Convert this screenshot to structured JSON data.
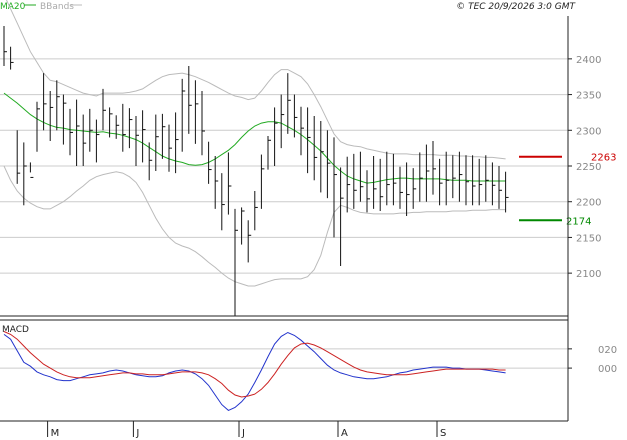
{
  "header": {
    "legend": [
      {
        "label": "MA20",
        "color": "#22aa22"
      },
      {
        "label": "BBands",
        "color": "#aaaaaa"
      }
    ],
    "copyright": "© TEC 20/9/2026 3:0 GMT"
  },
  "macd_label": "MACD",
  "colors": {
    "bar": "#111111",
    "ma": "#22aa22",
    "bands": "#bbbbbb",
    "grid": "#cccccc",
    "panel_border": "#222222",
    "resistance": "#cc0000",
    "support": "#008800",
    "macd": "#2233cc",
    "signal": "#cc2222",
    "axis_text": "#888888"
  },
  "chart_data": [
    {
      "type": "line",
      "subtype": "ohlc-bar",
      "title": "",
      "x_labels": [
        "M",
        "J",
        "J",
        "A",
        "S"
      ],
      "x_label_index": [
        6,
        19,
        35,
        50,
        65
      ],
      "yaxis": {
        "side": "right",
        "ticks": [
          2100,
          2150,
          2200,
          2250,
          2300,
          2350,
          2400
        ],
        "ylim": [
          2040,
          2460
        ]
      },
      "grid": true,
      "levels": [
        {
          "name": "resistance",
          "value": 2263,
          "label": "2263"
        },
        {
          "name": "support",
          "value": 2174,
          "label": "2174"
        }
      ],
      "series": [
        {
          "name": "Price",
          "kind": "ohlc",
          "high": [
            2446,
            2417,
            2300,
            2283,
            2241,
            2340,
            2380,
            2355,
            2370,
            2350,
            2330,
            2343,
            2322,
            2330,
            2315,
            2358,
            2332,
            2321,
            2337,
            2331,
            2320,
            2328,
            2283,
            2322,
            2323,
            2308,
            2325,
            2372,
            2390,
            2370,
            2355,
            2284,
            2264,
            2240,
            2269,
            2190,
            2192,
            2174,
            2215,
            2266,
            2292,
            2332,
            2350,
            2380,
            2350,
            2333,
            2332,
            2320,
            2313,
            2300,
            2290,
            2248,
            2263,
            2267,
            2270,
            2244,
            2264,
            2260,
            2270,
            2267,
            2249,
            2255,
            2247,
            2269,
            2280,
            2285,
            2260,
            2270,
            2265,
            2270,
            2265,
            2265,
            2260,
            2265,
            2255,
            2250,
            2242
          ],
          "low": [
            2390,
            2385,
            2225,
            2195,
            2255,
            2270,
            2300,
            2285,
            2300,
            2280,
            2265,
            2250,
            2250,
            2270,
            2255,
            2300,
            2290,
            2288,
            2270,
            2275,
            2250,
            2255,
            2230,
            2243,
            2260,
            2242,
            2240,
            2270,
            2295,
            2281,
            2265,
            2225,
            2190,
            2160,
            2182,
            2040,
            2140,
            2115,
            2160,
            2190,
            2245,
            2250,
            2275,
            2295,
            2290,
            2265,
            2240,
            2230,
            2213,
            2205,
            2150,
            2110,
            2185,
            2190,
            2200,
            2185,
            2190,
            2187,
            2195,
            2195,
            2190,
            2180,
            2190,
            2200,
            2200,
            2210,
            2195,
            2195,
            2205,
            2200,
            2195,
            2195,
            2195,
            2200,
            2195,
            2190,
            2185
          ],
          "close": [
            2410,
            2395,
            2240,
            2250,
            2234,
            2330,
            2337,
            2332,
            2347,
            2338,
            2297,
            2306,
            2282,
            2300,
            2294,
            2328,
            2323,
            2307,
            2294,
            2315,
            2293,
            2301,
            2258,
            2291,
            2305,
            2275,
            2287,
            2355,
            2335,
            2337,
            2299,
            2245,
            2229,
            2196,
            2222,
            2160,
            2187,
            2153,
            2192,
            2246,
            2286,
            2310,
            2322,
            2342,
            2318,
            2303,
            2290,
            2262,
            2270,
            2254,
            2238,
            2205,
            2224,
            2216,
            2221,
            2204,
            2218,
            2207,
            2224,
            2226,
            2213,
            2210,
            2218,
            2233,
            2243,
            2246,
            2226,
            2230,
            2233,
            2238,
            2228,
            2222,
            2224,
            2230,
            2223,
            2216,
            2206
          ]
        },
        {
          "name": "MA20",
          "values": [
            2352,
            2345,
            2338,
            2330,
            2322,
            2316,
            2311,
            2307,
            2304,
            2303,
            2301,
            2300,
            2299,
            2298,
            2297,
            2298,
            2296,
            2295,
            2293,
            2290,
            2287,
            2282,
            2276,
            2270,
            2264,
            2260,
            2257,
            2255,
            2252,
            2251,
            2252,
            2255,
            2260,
            2266,
            2272,
            2280,
            2290,
            2299,
            2306,
            2310,
            2312,
            2312,
            2310,
            2305,
            2300,
            2294,
            2287,
            2279,
            2271,
            2261,
            2251,
            2243,
            2236,
            2232,
            2229,
            2226,
            2227,
            2229,
            2231,
            2232,
            2233,
            2233,
            2232,
            2232,
            2232,
            2232,
            2232,
            2231,
            2230,
            2230,
            2230,
            2229,
            2229,
            2229,
            2229,
            2229,
            2229
          ]
        },
        {
          "name": "Upper Band",
          "values": [
            2490,
            2470,
            2450,
            2430,
            2410,
            2395,
            2380,
            2370,
            2368,
            2364,
            2360,
            2356,
            2352,
            2350,
            2348,
            2352,
            2352,
            2352,
            2352,
            2353,
            2355,
            2358,
            2364,
            2370,
            2375,
            2378,
            2379,
            2380,
            2378,
            2375,
            2371,
            2367,
            2362,
            2357,
            2352,
            2348,
            2346,
            2343,
            2345,
            2355,
            2367,
            2378,
            2385,
            2385,
            2380,
            2375,
            2365,
            2350,
            2333,
            2314,
            2295,
            2284,
            2280,
            2278,
            2277,
            2274,
            2272,
            2270,
            2268,
            2267,
            2267,
            2267,
            2266,
            2266,
            2266,
            2266,
            2265,
            2265,
            2265,
            2264,
            2264,
            2263,
            2263,
            2262,
            2262,
            2261,
            2260
          ]
        },
        {
          "name": "Lower Band",
          "values": [
            2250,
            2230,
            2215,
            2205,
            2198,
            2193,
            2190,
            2190,
            2195,
            2200,
            2207,
            2215,
            2222,
            2230,
            2235,
            2238,
            2240,
            2242,
            2240,
            2235,
            2227,
            2213,
            2195,
            2177,
            2162,
            2150,
            2142,
            2138,
            2135,
            2130,
            2123,
            2115,
            2108,
            2100,
            2093,
            2088,
            2085,
            2082,
            2082,
            2085,
            2088,
            2091,
            2092,
            2092,
            2092,
            2092,
            2095,
            2105,
            2125,
            2157,
            2185,
            2195,
            2192,
            2188,
            2185,
            2184,
            2183,
            2183,
            2183,
            2183,
            2184,
            2184,
            2185,
            2185,
            2186,
            2186,
            2186,
            2186,
            2187,
            2187,
            2187,
            2188,
            2188,
            2188,
            2189,
            2189,
            2189
          ]
        }
      ]
    },
    {
      "type": "line",
      "title": "MACD",
      "yaxis": {
        "side": "right",
        "ticks": [
          0,
          20
        ],
        "tick_labels": [
          "000",
          "020"
        ],
        "ylim": [
          -55,
          50
        ]
      },
      "series": [
        {
          "name": "MACD",
          "values": [
            35,
            30,
            18,
            6,
            2,
            -4,
            -7,
            -9,
            -12,
            -13,
            -13,
            -11,
            -9,
            -7,
            -6,
            -5,
            -3,
            -2,
            -3,
            -5,
            -7,
            -8,
            -9,
            -9,
            -8,
            -5,
            -3,
            -2,
            -3,
            -6,
            -11,
            -18,
            -28,
            -38,
            -44,
            -41,
            -35,
            -27,
            -15,
            -2,
            12,
            25,
            33,
            37,
            34,
            29,
            23,
            17,
            10,
            3,
            -2,
            -5,
            -7,
            -9,
            -10,
            -11,
            -11,
            -10,
            -9,
            -7,
            -5,
            -4,
            -2,
            -1,
            0,
            1,
            1,
            1,
            0,
            0,
            -1,
            -1,
            -1,
            -2,
            -3,
            -4,
            -5
          ]
        },
        {
          "name": "Signal",
          "values": [
            38,
            35,
            30,
            23,
            16,
            10,
            4,
            0,
            -4,
            -7,
            -9,
            -10,
            -10,
            -10,
            -9,
            -8,
            -7,
            -6,
            -5,
            -5,
            -6,
            -6,
            -7,
            -7,
            -7,
            -6,
            -5,
            -4,
            -4,
            -4,
            -5,
            -7,
            -11,
            -16,
            -23,
            -28,
            -30,
            -29,
            -27,
            -22,
            -15,
            -6,
            4,
            13,
            21,
            25,
            26,
            24,
            21,
            17,
            13,
            9,
            5,
            1,
            -2,
            -4,
            -5,
            -6,
            -7,
            -7,
            -7,
            -7,
            -6,
            -5,
            -4,
            -3,
            -2,
            -1,
            -1,
            -1,
            -1,
            -1,
            -1,
            -1,
            -1,
            -2,
            -2
          ]
        }
      ]
    }
  ]
}
